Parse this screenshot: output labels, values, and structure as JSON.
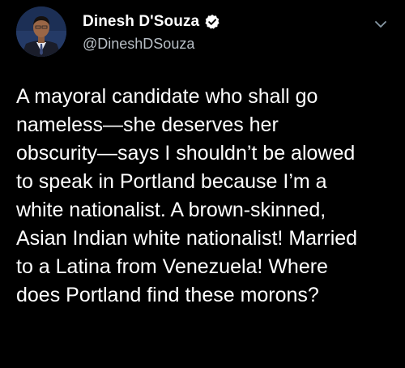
{
  "tweet": {
    "author": {
      "display_name": "Dinesh D'Souza",
      "handle": "@DineshDSouza",
      "verified": true
    },
    "text_lines": [
      "A mayoral candidate who shall go",
      "nameless—she deserves her",
      "obscurity—says I shouldn’t be alowed",
      "to speak in Portland because I’m a",
      "white nationalist. A brown-skinned,",
      "Asian Indian white nationalist!  Married",
      "to a Latina from Venezuela! Where",
      "does Portland find these morons?"
    ]
  },
  "icons": {
    "verified": "verified-badge-icon",
    "menu": "chevron-down-icon"
  },
  "colors": {
    "background": "#000000",
    "text": "#ffffff",
    "handle": "#b8bfc6",
    "chevron": "#8899a6"
  }
}
